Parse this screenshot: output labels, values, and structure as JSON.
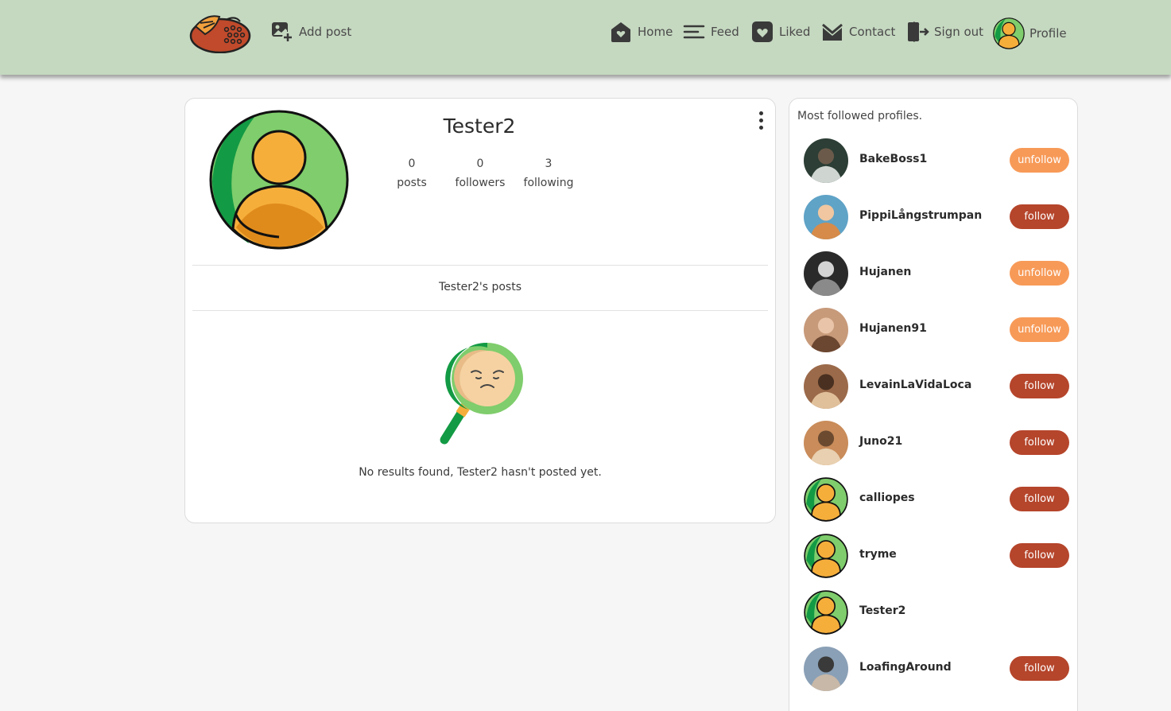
{
  "nav": {
    "add_post": "Add post",
    "home": "Home",
    "feed": "Feed",
    "liked": "Liked",
    "contact": "Contact",
    "sign_out": "Sign out",
    "profile": "Profile"
  },
  "profile": {
    "username": "Tester2",
    "stats": [
      {
        "value": "0",
        "label": "posts"
      },
      {
        "value": "0",
        "label": "followers"
      },
      {
        "value": "3",
        "label": "following"
      }
    ],
    "posts_heading": "Tester2's posts",
    "no_results": "No results found, Tester2 hasn't posted yet."
  },
  "sidebar": {
    "title": "Most followed profiles.",
    "profiles": [
      {
        "name": "BakeBoss1",
        "button": "unfollow",
        "avatar": "photo"
      },
      {
        "name": "PippiLångstrumpan",
        "button": "follow",
        "avatar": "photo"
      },
      {
        "name": "Hujanen",
        "button": "unfollow",
        "avatar": "photo"
      },
      {
        "name": "Hujanen91",
        "button": "unfollow",
        "avatar": "photo"
      },
      {
        "name": "LevainLaVidaLoca",
        "button": "follow",
        "avatar": "photo"
      },
      {
        "name": "Juno21",
        "button": "follow",
        "avatar": "photo"
      },
      {
        "name": "calliopes",
        "button": "follow",
        "avatar": "default"
      },
      {
        "name": "tryme",
        "button": "follow",
        "avatar": "default"
      },
      {
        "name": "Tester2",
        "button": "",
        "avatar": "default"
      },
      {
        "name": "LoafingAround",
        "button": "follow",
        "avatar": "photo"
      }
    ]
  },
  "colors": {
    "navbar": "#c5d8c0",
    "follow": "#b5452b",
    "unfollow": "#f79a58",
    "avatar_green": "#7fcd6c",
    "avatar_orange": "#f6ae3b"
  }
}
